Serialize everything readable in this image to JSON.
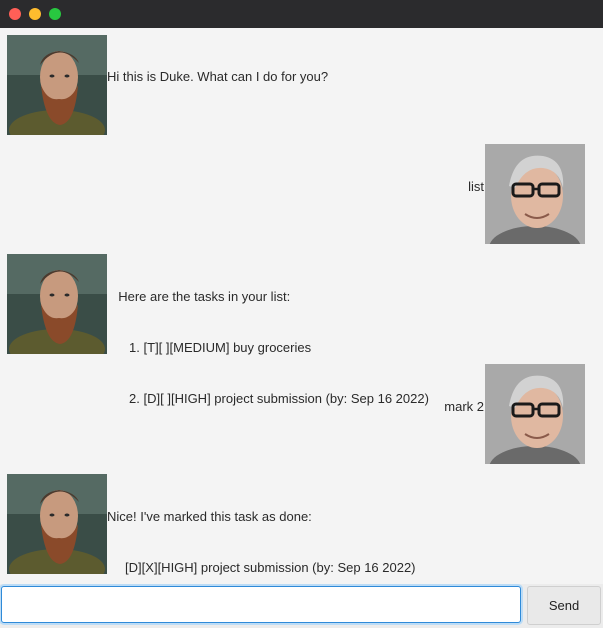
{
  "window": {
    "title": ""
  },
  "messages": [
    {
      "sender": "duke",
      "lines": [
        "Hi this is Duke. What can I do for you?"
      ]
    },
    {
      "sender": "user",
      "lines": [
        "list"
      ]
    },
    {
      "sender": "duke",
      "lines": [
        "  Here are the tasks in your list:",
        "     1. [T][ ][MEDIUM] buy groceries",
        "     2. [D][ ][HIGH] project submission (by: Sep 16 2022)"
      ]
    },
    {
      "sender": "user",
      "lines": [
        "mark 2"
      ]
    },
    {
      "sender": "duke",
      "lines": [
        "Nice! I've marked this task as done:",
        "     [D][X][HIGH] project submission (by: Sep 16 2022)"
      ]
    }
  ],
  "avatars": {
    "duke": "bearded-man-avatar",
    "user": "glasses-man-avatar"
  },
  "input": {
    "value": "",
    "placeholder": ""
  },
  "send_label": "Send",
  "colors": {
    "focus_border": "#2f8ad8",
    "background": "#f4f4f4",
    "titlebar": "#2b2b2d"
  }
}
